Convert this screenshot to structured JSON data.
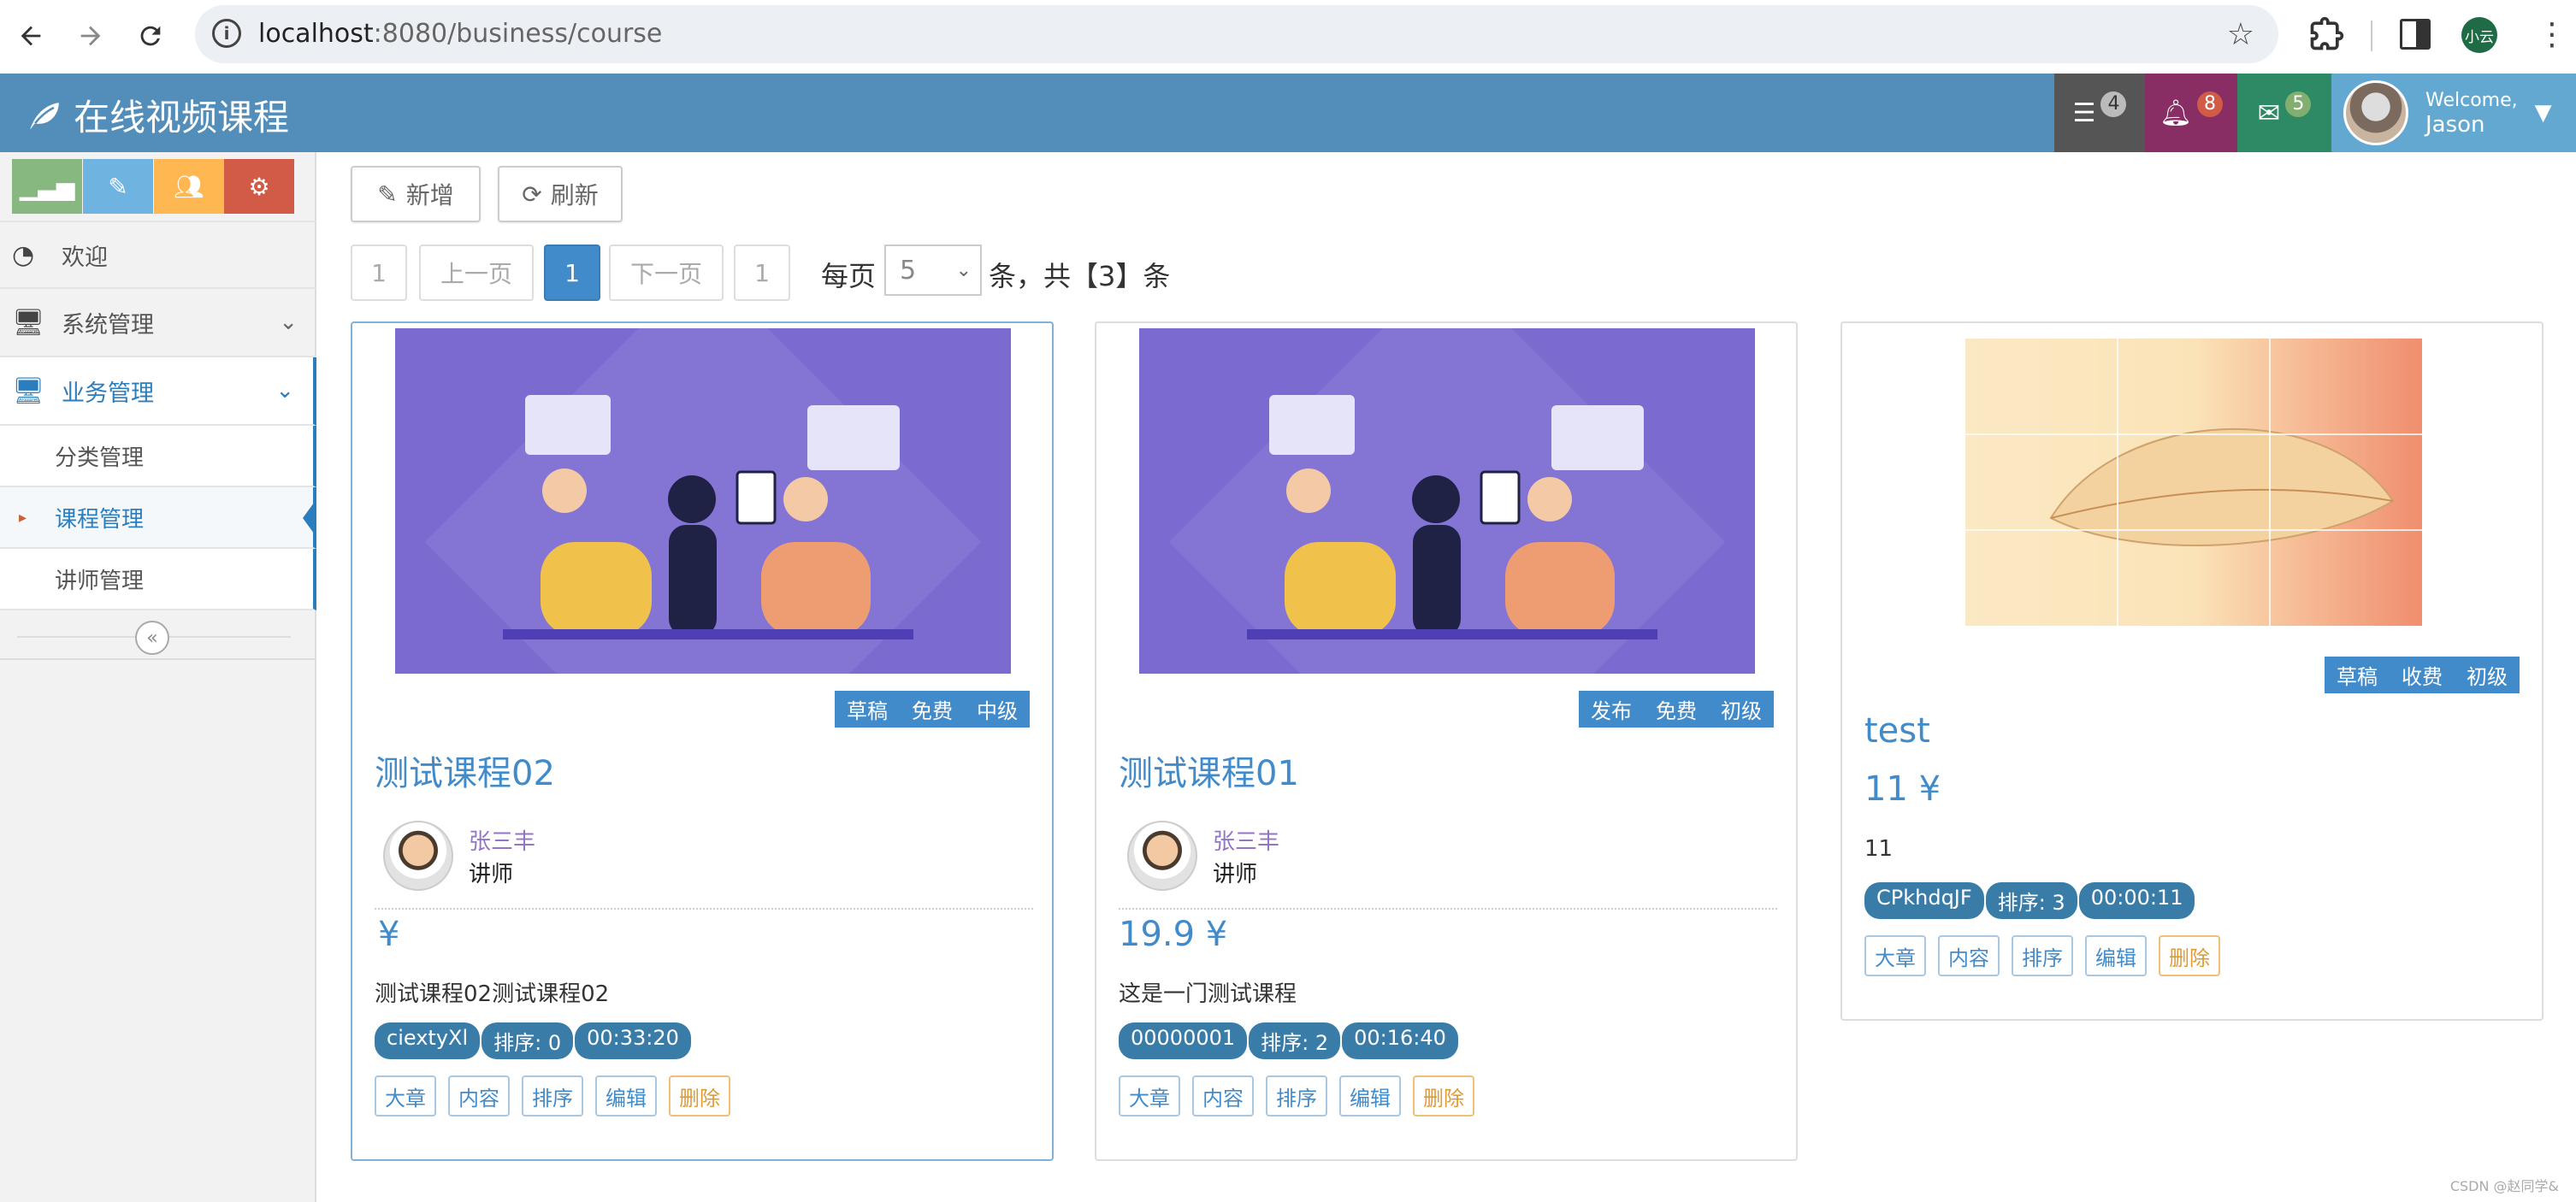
{
  "browser": {
    "url_host": "localhost",
    "url_rest": ":8080/business/course",
    "profile_label": "小云"
  },
  "navbar": {
    "brand": "在线视频课程",
    "tasks_count": "4",
    "notifications_count": "8",
    "messages_count": "5",
    "welcome": "Welcome,",
    "user_name": "Jason"
  },
  "sidebar": {
    "menu": {
      "welcome": "欢迎",
      "system": "系统管理",
      "business": "业务管理"
    },
    "submenu": {
      "category": "分类管理",
      "course": "课程管理",
      "teacher": "讲师管理"
    }
  },
  "toolbar": {
    "add": "新增",
    "refresh": "刷新"
  },
  "pagination": {
    "first": "1",
    "prev": "上一页",
    "current": "1",
    "next": "下一页",
    "last": "1",
    "per_page_label": "每页",
    "per_page_value": "5",
    "total_text": "条，共【3】条"
  },
  "courses": [
    {
      "tags": [
        "草稿",
        "免费",
        "中级"
      ],
      "title": "测试课程02",
      "teacher_name": "张三丰",
      "teacher_role": "讲师",
      "price": "¥",
      "summary": "测试课程02测试课程02",
      "pills": [
        "ciextyXl",
        "排序: 0",
        "00:33:20"
      ],
      "actions": [
        "大章",
        "内容",
        "排序",
        "编辑",
        "删除"
      ]
    },
    {
      "tags": [
        "发布",
        "免费",
        "初级"
      ],
      "title": "测试课程01",
      "teacher_name": "张三丰",
      "teacher_role": "讲师",
      "price": "19.9 ¥",
      "summary": "这是一门测试课程",
      "pills": [
        "00000001",
        "排序: 2",
        "00:16:40"
      ],
      "actions": [
        "大章",
        "内容",
        "排序",
        "编辑",
        "删除"
      ]
    },
    {
      "tags": [
        "草稿",
        "收费",
        "初级"
      ],
      "title": "test",
      "price": "11 ¥",
      "summary": "11",
      "pills": [
        "CPkhdqJF",
        "排序: 3",
        "00:00:11"
      ],
      "actions": [
        "大章",
        "内容",
        "排序",
        "编辑",
        "删除"
      ]
    }
  ],
  "watermark": "CSDN @赵同学&",
  "colors": {
    "navbar": "#538ebb",
    "primary": "#428bca",
    "shortcut_green": "#87b87f",
    "shortcut_blue": "#6fb3e0",
    "shortcut_orange": "#ffb752",
    "shortcut_red": "#d15b47"
  }
}
